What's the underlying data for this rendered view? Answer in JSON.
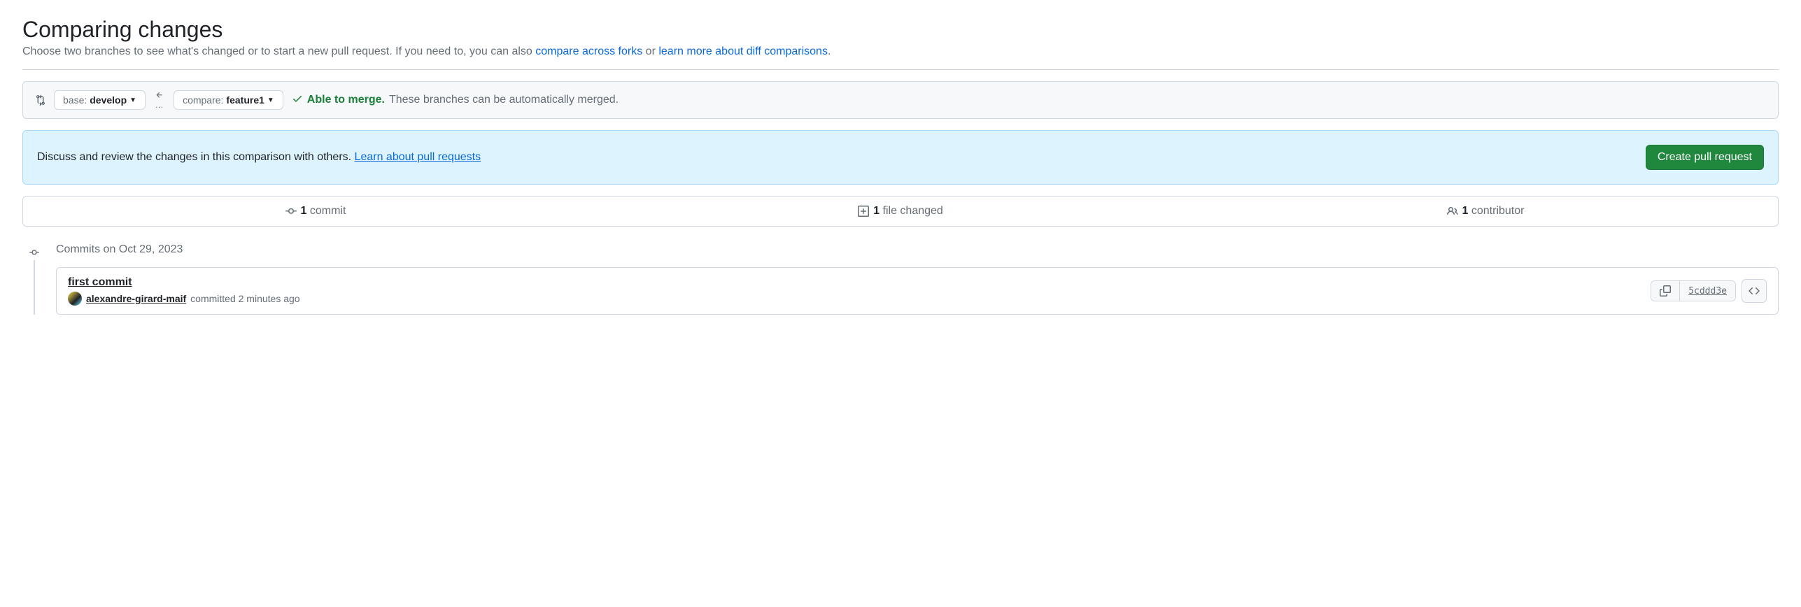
{
  "header": {
    "title": "Comparing changes",
    "subtitle_prefix": "Choose two branches to see what's changed or to start a new pull request. If you need to, you can also ",
    "link_forks": "compare across forks",
    "or_text": " or ",
    "link_diff": "learn more about diff comparisons",
    "period": "."
  },
  "range": {
    "base_label": "base: ",
    "base_branch": "develop",
    "compare_label": "compare: ",
    "compare_branch": "feature1",
    "merge_status_able": "Able to merge.",
    "merge_status_text": "These branches can be automatically merged."
  },
  "flash": {
    "text_prefix": "Discuss and review the changes in this comparison with others. ",
    "learn_link": "Learn about pull requests",
    "button": "Create pull request"
  },
  "tabs": {
    "commits_count": "1",
    "commits_label": " commit",
    "files_count": "1",
    "files_label": " file changed",
    "contributors_count": "1",
    "contributors_label": " contributor"
  },
  "commits": {
    "date_header": "Commits on Oct 29, 2023",
    "items": [
      {
        "title": "first commit",
        "author": "alexandre-girard-maif",
        "meta": " committed 2 minutes ago",
        "sha": "5cddd3e"
      }
    ]
  }
}
